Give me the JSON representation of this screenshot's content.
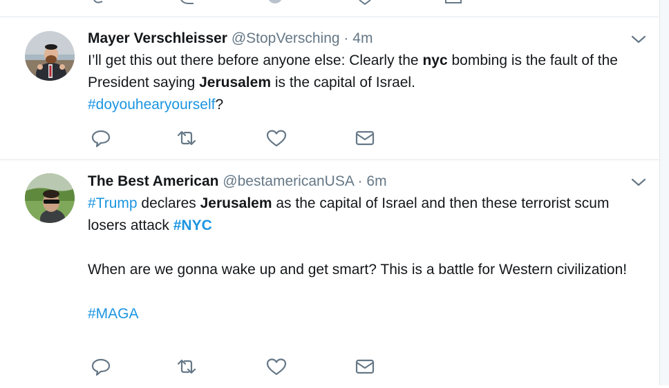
{
  "tweets": [
    {
      "name": "Mayer Verschleisser",
      "handle": "@StopVersching",
      "separator": "·",
      "time": "4m",
      "body": {
        "t1": "I’ll get this out there before anyone else: Clearly the ",
        "b1": "nyc",
        "t2": " bombing is the fault of the President saying ",
        "b2": "Jerusalem",
        "t3": " is the capital of Israel.",
        "hashtag": "#doyouhearyourself",
        "t4": "?"
      },
      "actions": [
        "reply-icon",
        "retweet-icon",
        "like-icon",
        "direct-message-icon"
      ]
    },
    {
      "name": "The Best American",
      "handle": "@bestamericanUSA",
      "separator": "·",
      "time": "6m",
      "body": {
        "hashtag1": "#Trump",
        "t1": " declares ",
        "b1": "Jerusalem",
        "t2": " as the capital of Israel and then these terrorist scum losers attack ",
        "hashtag2": "#NYC",
        "para2": "When are we gonna wake up and get smart? This is a battle for Western civilization!",
        "hashtag3": "#MAGA"
      },
      "actions": [
        "reply-icon",
        "retweet-icon",
        "like-icon",
        "direct-message-icon"
      ]
    }
  ],
  "colors": {
    "link": "#1b95e0",
    "secondary_text": "#657786",
    "primary_text": "#14171a",
    "divider": "#e1e8ed"
  }
}
